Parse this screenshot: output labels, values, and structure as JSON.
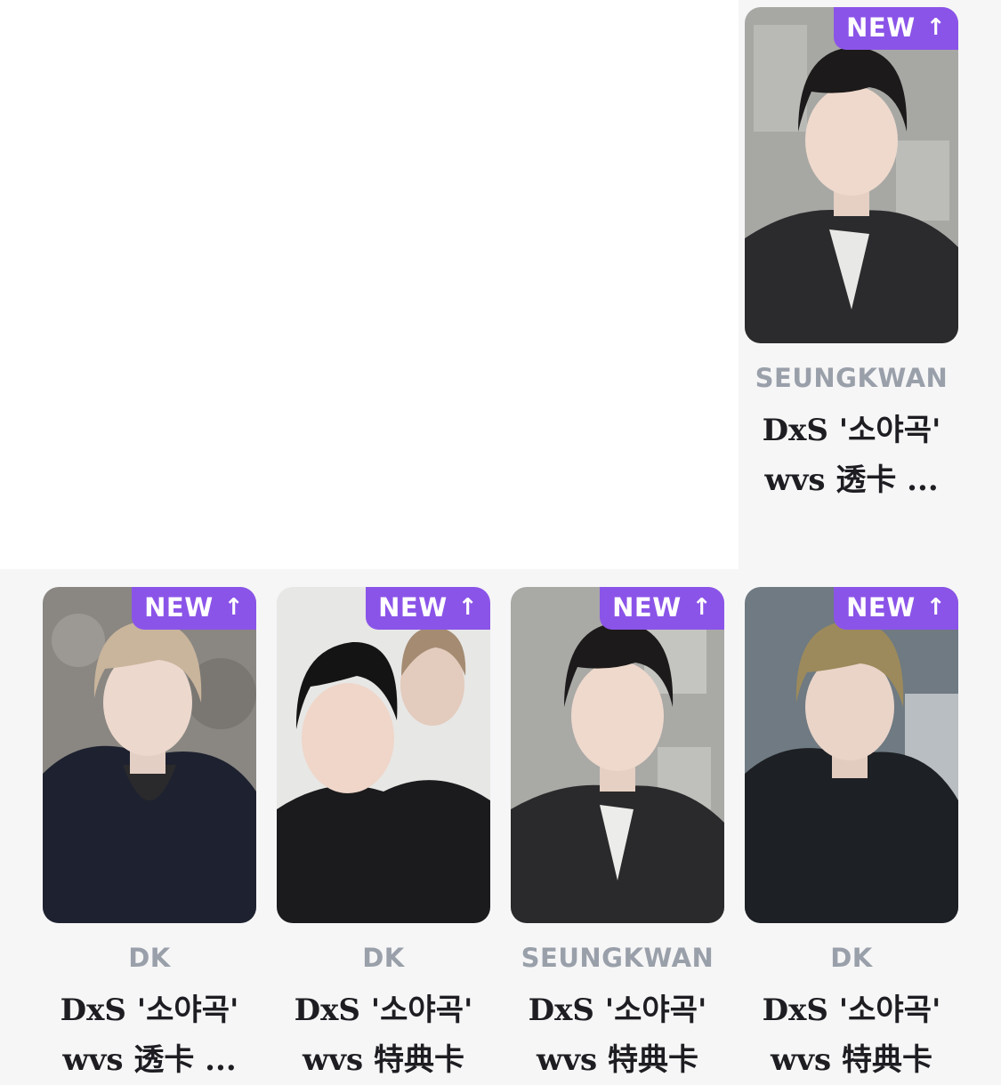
{
  "cards": [
    {
      "artist": "SEUNGKWAN",
      "title_line1": "DxS '소야곡'",
      "title_line2": "wvs 透卡 ...",
      "badge": "NEW",
      "badge_icon": "arrow-up-icon"
    },
    {
      "artist": "DK",
      "title_line1": "DxS '소야곡'",
      "title_line2": "wvs 透卡 ...",
      "badge": "NEW",
      "badge_icon": "arrow-up-icon"
    },
    {
      "artist": "DK",
      "title_line1": "DxS '소야곡'",
      "title_line2": "wvs 特典卡",
      "badge": "NEW",
      "badge_icon": "arrow-up-icon"
    },
    {
      "artist": "SEUNGKWAN",
      "title_line1": "DxS '소야곡'",
      "title_line2": "wvs 特典卡",
      "badge": "NEW",
      "badge_icon": "arrow-up-icon"
    },
    {
      "artist": "DK",
      "title_line1": "DxS '소야곡'",
      "title_line2": "wvs 特典卡",
      "badge": "NEW",
      "badge_icon": "arrow-up-icon"
    }
  ],
  "colors": {
    "badge_bg": "#8b54e8",
    "artist_text": "#9aa0aa",
    "title_text": "#1d1d22",
    "page_bg": "#f6f6f7"
  }
}
